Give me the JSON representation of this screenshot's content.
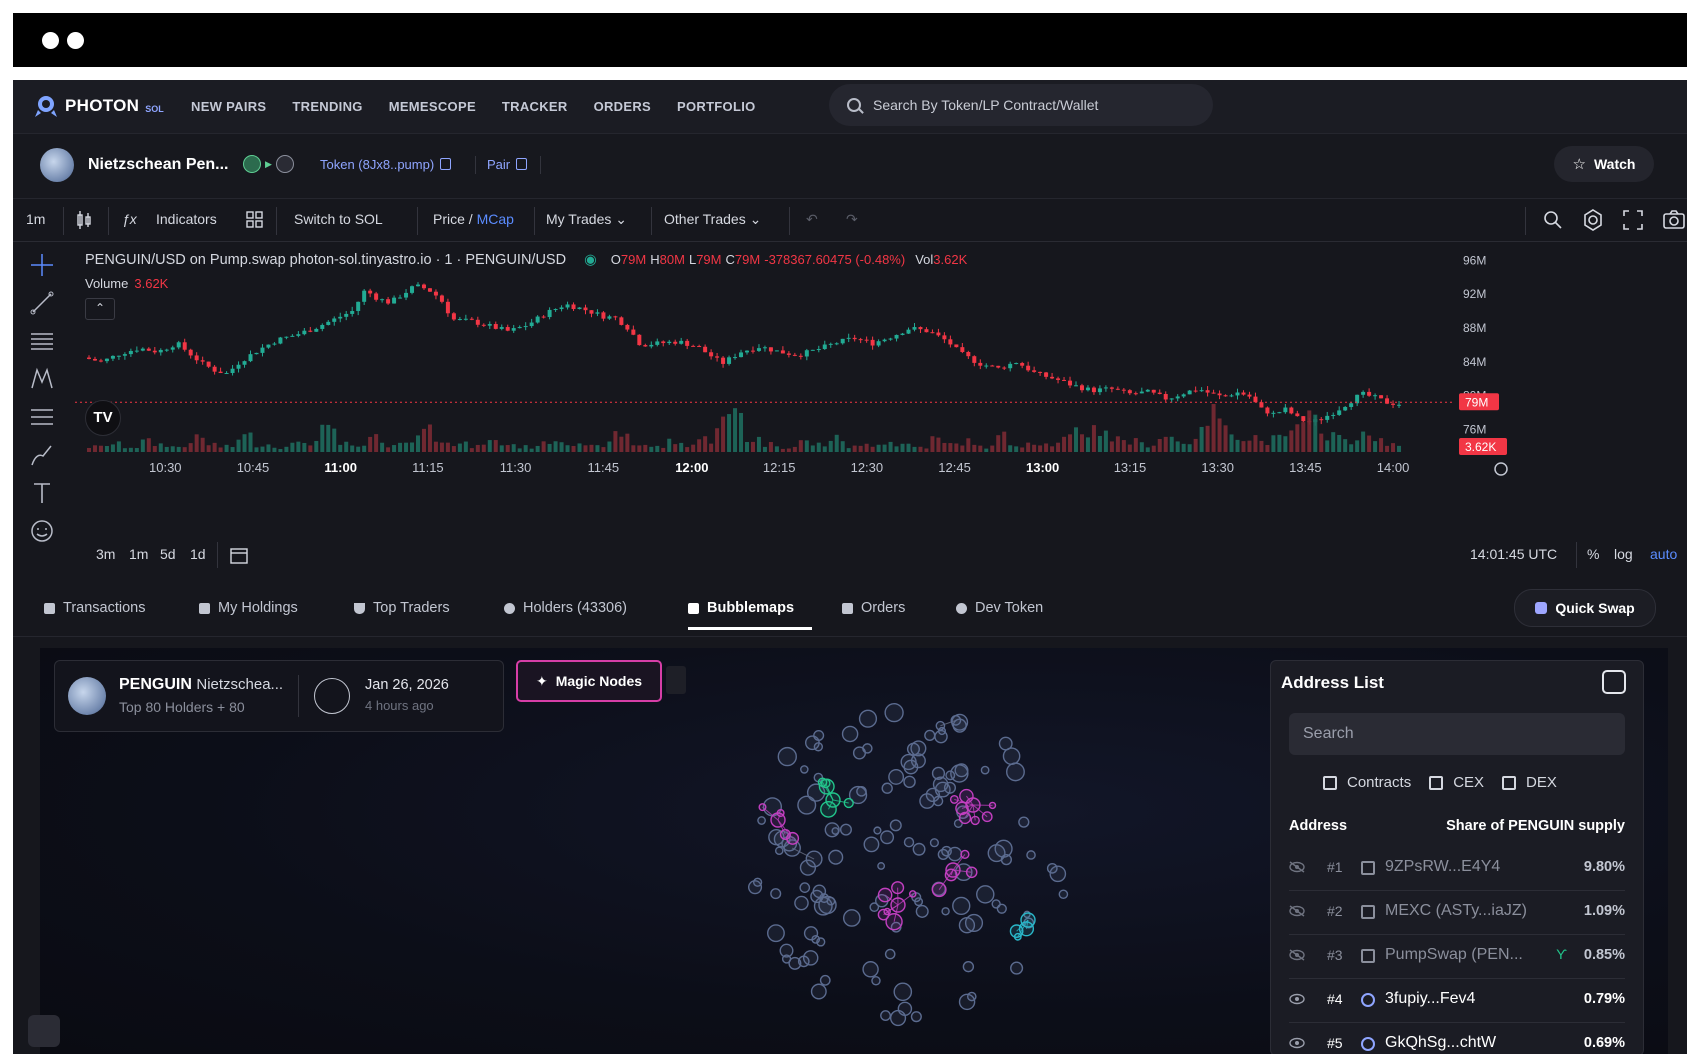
{
  "window": {
    "controls": [
      "dot",
      "dot"
    ]
  },
  "nav": {
    "brand": "PHOTON",
    "brand_sub": "SOL",
    "links": [
      "NEW PAIRS",
      "TRENDING",
      "MEMESCOPE",
      "TRACKER",
      "ORDERS",
      "PORTFOLIO"
    ],
    "search_placeholder": "Search By Token/LP Contract/Wallet"
  },
  "token": {
    "name": "Nietzschean Pen...",
    "token_link": "Token (8Jx8..pump)",
    "pair_link": "Pair",
    "watch_label": "Watch"
  },
  "chart_toolbar": {
    "interval": "1m",
    "indicators": "Indicators",
    "switch": "Switch to SOL",
    "price_label": "Price /",
    "mcap_label": "MCap",
    "my_trades": "My Trades",
    "other_trades": "Other Trades"
  },
  "chart": {
    "legend_pair": "PENGUIN/USD on Pump.swap photon-sol.tinyastro.io · 1 · PENGUIN/USD",
    "o_label": "O",
    "o_value": "79M",
    "h_label": "H",
    "h_value": "80M",
    "l_label": "L",
    "l_value": "79M",
    "c_label": "C",
    "c_value": "79M",
    "change": "-378367.60475 (-0.48%)",
    "vol_label": "Vol",
    "vol_value": "3.62K",
    "volume_title": "Volume",
    "volume_value": "3.62K",
    "price_tag": "79M",
    "vol_tag": "3.62K",
    "time": "14:01:45 UTC",
    "pct": "%",
    "log": "log",
    "auto": "auto",
    "ranges": [
      "3m",
      "1m",
      "5d",
      "1d"
    ]
  },
  "chart_data": {
    "type": "candlestick",
    "x_ticks": [
      "10:30",
      "10:45",
      "11:00",
      "11:15",
      "11:30",
      "11:45",
      "12:00",
      "12:15",
      "12:30",
      "12:45",
      "13:00",
      "13:15",
      "13:30",
      "13:45",
      "14:00"
    ],
    "x_ticks_bold": [
      "11:00",
      "12:00",
      "13:00"
    ],
    "y_ticks": [
      "96M",
      "92M",
      "88M",
      "84M",
      "80M",
      "76M"
    ],
    "y_tick_values": [
      96,
      92,
      88,
      84,
      80,
      76
    ],
    "ylim": [
      74.5,
      97
    ],
    "close_path": [
      [
        0,
        84.5
      ],
      [
        6,
        84.0
      ],
      [
        12,
        85.0
      ],
      [
        18,
        85.6
      ],
      [
        24,
        85.2
      ],
      [
        30,
        86.2
      ],
      [
        34,
        85.0
      ],
      [
        38,
        83.8
      ],
      [
        42,
        83.0
      ],
      [
        46,
        82.6
      ],
      [
        50,
        84.0
      ],
      [
        56,
        85.4
      ],
      [
        62,
        86.6
      ],
      [
        68,
        87.2
      ],
      [
        74,
        88.0
      ],
      [
        80,
        89.0
      ],
      [
        86,
        90.0
      ],
      [
        90,
        92.5
      ],
      [
        94,
        91.5
      ],
      [
        98,
        91.0
      ],
      [
        102,
        92.0
      ],
      [
        106,
        93.0
      ],
      [
        110,
        92.6
      ],
      [
        114,
        91.5
      ],
      [
        118,
        89.0
      ],
      [
        124,
        88.8
      ],
      [
        130,
        88.2
      ],
      [
        136,
        87.6
      ],
      [
        142,
        88.4
      ],
      [
        148,
        89.8
      ],
      [
        154,
        90.8
      ],
      [
        160,
        90.2
      ],
      [
        166,
        89.4
      ],
      [
        170,
        89.2
      ],
      [
        174,
        88.0
      ],
      [
        178,
        86.0
      ],
      [
        184,
        86.2
      ],
      [
        190,
        86.4
      ],
      [
        196,
        85.8
      ],
      [
        200,
        84.8
      ],
      [
        204,
        83.8
      ],
      [
        210,
        85.2
      ],
      [
        216,
        85.8
      ],
      [
        222,
        85.2
      ],
      [
        228,
        84.8
      ],
      [
        234,
        85.4
      ],
      [
        240,
        86.2
      ],
      [
        246,
        86.8
      ],
      [
        252,
        86.2
      ],
      [
        258,
        87.0
      ],
      [
        264,
        88.0
      ],
      [
        270,
        87.6
      ],
      [
        276,
        86.4
      ],
      [
        280,
        85.0
      ],
      [
        286,
        83.8
      ],
      [
        292,
        83.2
      ],
      [
        298,
        84.0
      ],
      [
        304,
        82.6
      ],
      [
        310,
        82.0
      ],
      [
        316,
        81.2
      ],
      [
        322,
        80.6
      ],
      [
        328,
        80.8
      ],
      [
        334,
        80.2
      ],
      [
        340,
        80.4
      ],
      [
        346,
        79.6
      ],
      [
        352,
        80.4
      ],
      [
        356,
        80.8
      ],
      [
        360,
        80.2
      ],
      [
        364,
        79.8
      ],
      [
        368,
        80.4
      ],
      [
        372,
        80.0
      ],
      [
        376,
        78.4
      ],
      [
        380,
        77.8
      ],
      [
        384,
        78.4
      ],
      [
        388,
        77.2
      ],
      [
        392,
        76.8
      ],
      [
        396,
        77.4
      ],
      [
        400,
        78.2
      ],
      [
        404,
        79.2
      ],
      [
        408,
        80.2
      ],
      [
        412,
        79.8
      ],
      [
        416,
        79.2
      ],
      [
        420,
        79.0
      ]
    ],
    "close_path_note": "",
    "volume_levels": [
      2,
      3,
      2,
      4,
      3,
      2,
      5,
      3,
      2,
      6,
      3,
      2,
      3,
      4,
      8,
      3,
      2,
      5,
      3,
      4,
      9,
      6,
      3,
      2,
      4,
      3,
      2,
      3,
      5,
      4,
      2,
      3,
      7,
      3,
      2,
      4,
      3,
      5,
      12,
      16,
      5,
      3,
      2,
      4,
      3,
      5,
      2,
      3,
      4,
      3,
      2,
      5,
      3,
      4,
      2,
      6,
      3,
      4,
      3,
      5,
      8,
      9,
      5,
      4,
      3,
      6,
      4,
      7,
      15,
      8,
      6,
      4,
      5,
      9,
      12,
      7,
      5,
      6,
      4,
      3
    ]
  },
  "tabs": [
    {
      "label": "Transactions",
      "active": false
    },
    {
      "label": "My Holdings",
      "active": false
    },
    {
      "label": "Top Traders",
      "active": false
    },
    {
      "label": "Holders (43306)",
      "active": false
    },
    {
      "label": "Bubblemaps",
      "active": true
    },
    {
      "label": "Orders",
      "active": false
    },
    {
      "label": "Dev Token",
      "active": false
    }
  ],
  "quick_swap": "Quick Swap",
  "bubblemap": {
    "symbol": "PENGUIN",
    "name": "Nietzschea...",
    "subtitle": "Top 80 Holders + 80",
    "date": "Jan 26, 2026",
    "ago": "4 hours ago",
    "magic_nodes": "Magic Nodes"
  },
  "address_list": {
    "title": "Address List",
    "search_placeholder": "Search",
    "filters": [
      "Contracts",
      "CEX",
      "DEX"
    ],
    "col_address": "Address",
    "col_share": "Share of PENGUIN supply",
    "rows": [
      {
        "rank": "#1",
        "name": "9ZPsRW...E4Y4",
        "share": "9.80%",
        "hidden": true,
        "icon": "document-icon"
      },
      {
        "rank": "#2",
        "name": "MEXC (ASTy...iaJZ)",
        "share": "1.09%",
        "hidden": true,
        "icon": "exchange-icon"
      },
      {
        "rank": "#3",
        "name": "PumpSwap (PEN...",
        "share": "0.85%",
        "hidden": true,
        "icon": "pill-icon"
      },
      {
        "rank": "#4",
        "name": "3fupiy...Fev4",
        "share": "0.79%",
        "hidden": false,
        "icon": "wallet-circle-icon"
      },
      {
        "rank": "#5",
        "name": "GkQhSg...chtW",
        "share": "0.69%",
        "hidden": false,
        "icon": "wallet-circle-icon"
      }
    ]
  },
  "colors": {
    "up": "#22ab94",
    "down": "#f23645",
    "accent": "#8fa5ff",
    "magic": "#d63ea7",
    "bubble_pink": "#c23fc0",
    "bubble_green": "#22c58b",
    "bubble_teal": "#2ab7c9",
    "bubble_neutral": "#5b6b8f"
  }
}
